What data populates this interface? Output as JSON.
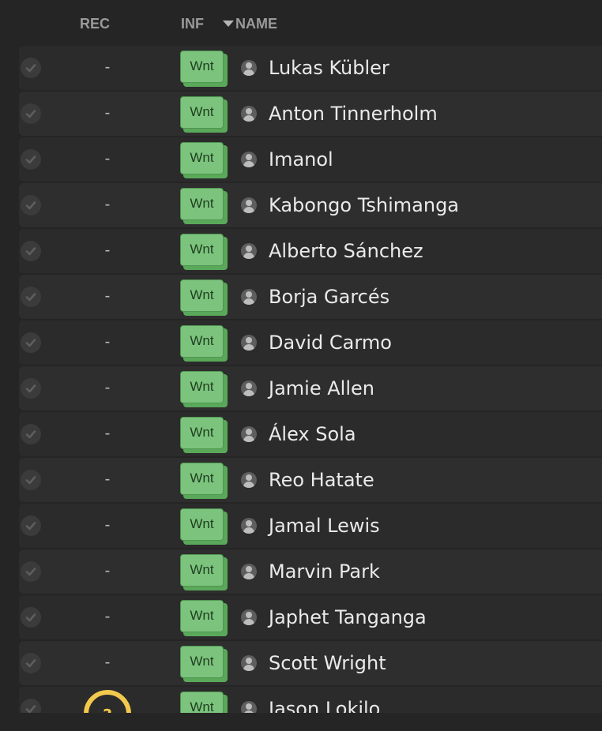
{
  "header": {
    "rec_label": "REC",
    "inf_label": "INF",
    "name_label": "NAME",
    "sort_icon": "sort-descending-icon"
  },
  "colors": {
    "background": "#252525",
    "row": "#2b2b2b",
    "header_text": "#9a9a9a",
    "wnt_badge": "#7cc47d",
    "wnt_badge_shadow": "#5aa85a",
    "rec_highlight": "#f2c94c"
  },
  "rows": [
    {
      "rec": "-",
      "inf": "Wnt",
      "name": "Lukas Kübler"
    },
    {
      "rec": "-",
      "inf": "Wnt",
      "name": "Anton Tinnerholm"
    },
    {
      "rec": "-",
      "inf": "Wnt",
      "name": "Imanol"
    },
    {
      "rec": "-",
      "inf": "Wnt",
      "name": "Kabongo Tshimanga"
    },
    {
      "rec": "-",
      "inf": "Wnt",
      "name": "Alberto Sánchez"
    },
    {
      "rec": "-",
      "inf": "Wnt",
      "name": "Borja Garcés"
    },
    {
      "rec": "-",
      "inf": "Wnt",
      "name": "David Carmo"
    },
    {
      "rec": "-",
      "inf": "Wnt",
      "name": "Jamie Allen"
    },
    {
      "rec": "-",
      "inf": "Wnt",
      "name": "Álex Sola"
    },
    {
      "rec": "-",
      "inf": "Wnt",
      "name": "Reo Hatate"
    },
    {
      "rec": "-",
      "inf": "Wnt",
      "name": "Jamal Lewis"
    },
    {
      "rec": "-",
      "inf": "Wnt",
      "name": "Marvin Park"
    },
    {
      "rec": "-",
      "inf": "Wnt",
      "name": "Japhet Tanganga"
    },
    {
      "rec": "-",
      "inf": "Wnt",
      "name": "Scott Wright"
    },
    {
      "rec": "?",
      "inf": "Wnt",
      "name": "Jason Lokilo"
    }
  ]
}
